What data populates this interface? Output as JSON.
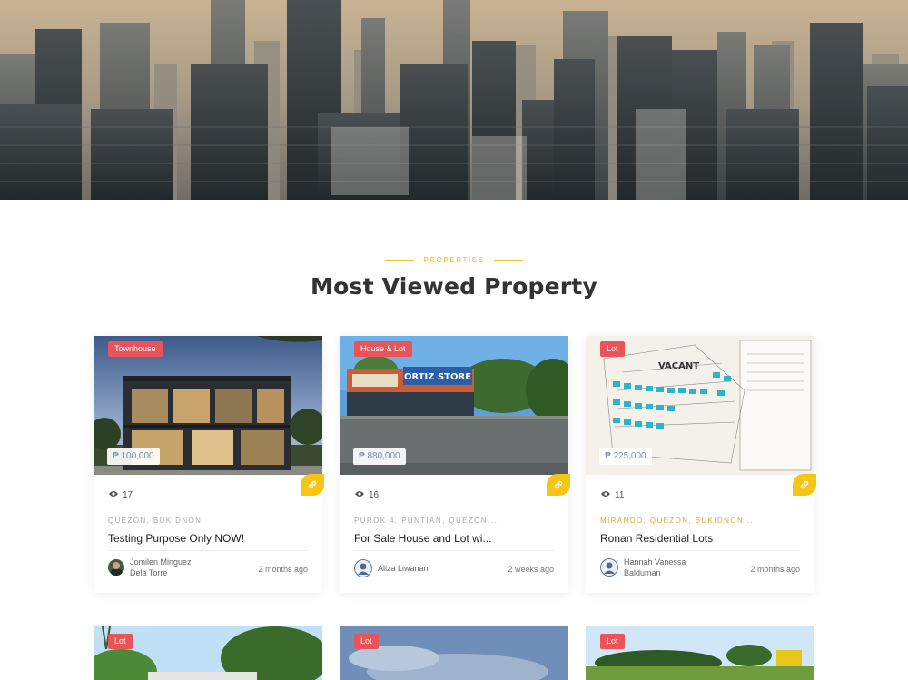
{
  "hero": {
    "image": "city-skyline-photo"
  },
  "section": {
    "eyebrow": "PROPERTIES",
    "title": "Most Viewed Property"
  },
  "cards": [
    {
      "category": "Townhouse",
      "price": "₱ 100,000",
      "views": "17",
      "location": "QUEZON, BUKIDNON",
      "title": "Testing Purpose Only NOW!",
      "author": "Jomilen Minguez Dela Torre",
      "posted": "2 months ago"
    },
    {
      "category": "House & Lot",
      "price": "₱ 880,000",
      "views": "16",
      "location": "PUROK 4, PUNTIAN, QUEZON,...",
      "title": "For Sale House and Lot wi...",
      "author": "Aliza Liwanan",
      "posted": "2 weeks ago",
      "store_sign": "ORTIZ STORE"
    },
    {
      "category": "Lot",
      "price": "₱ 225,000",
      "views": "11",
      "location": "MIRANDO, QUEZON, BUKIDNON...",
      "title": "Ronan Residential Lots",
      "author": "Hannah Vanessa Balduman",
      "posted": "2 months ago",
      "map_label": "VACANT"
    }
  ],
  "cards_row2": [
    {
      "category": "Lot"
    },
    {
      "category": "Lot"
    },
    {
      "category": "Lot"
    }
  ],
  "icons": {
    "eye": "eye-icon",
    "link": "link-icon",
    "user": "user-avatar-icon"
  },
  "colors": {
    "accent": "#f5c518",
    "tag": "#e8545a",
    "price_text": "#7a8ea3",
    "title": "#333333"
  }
}
